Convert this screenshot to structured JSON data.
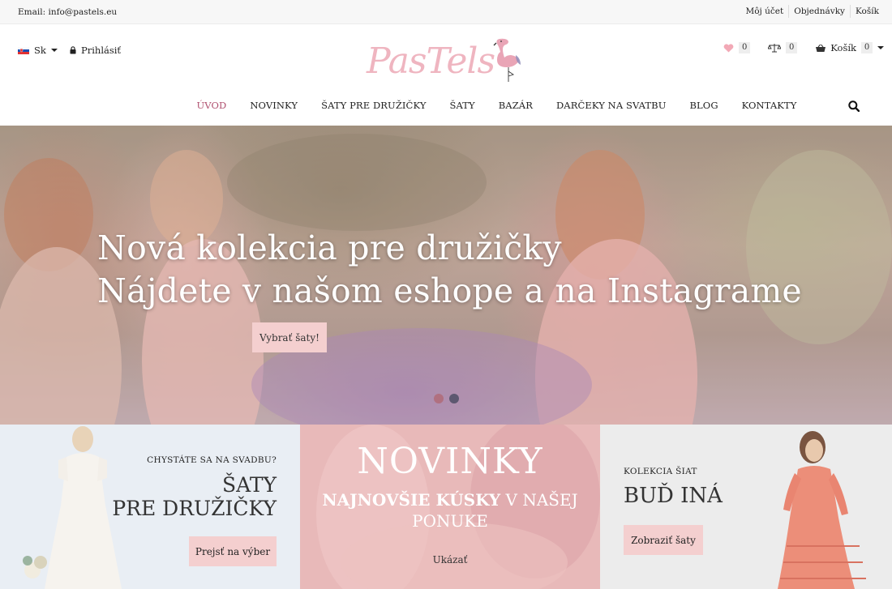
{
  "topbar": {
    "email": "Email: info@pastels.eu",
    "links": [
      "Môj účet",
      "Objednávky",
      "Košík"
    ]
  },
  "header": {
    "language": "Sk",
    "login": "Prihlásiť",
    "logo_text": "PasTels",
    "wishlist_count": "0",
    "compare_count": "0",
    "cart_label": "Košík",
    "cart_count": "0"
  },
  "nav": {
    "items": [
      "ÚVOD",
      "NOVINKY",
      "ŠATY PRE DRUŽIČKY",
      "ŠATY",
      "BAZÁR",
      "DARČEKY NA SVATBU",
      "BLOG",
      "KONTAKTY"
    ],
    "active_index": 0
  },
  "hero": {
    "line1": "Nová kolekcia pre družičky",
    "line2": "Nájdete v našom eshope a na Instagrame",
    "button": "Vybrať šaty!",
    "dot_colors": [
      "#b07080",
      "#5d5870"
    ]
  },
  "promos": {
    "bridesmaids": {
      "kicker": "CHYSTÁTE SA NA SVADBU?",
      "line1": "ŠATY",
      "line2": "PRE DRUŽIČKY",
      "button": "Prejsť na výber"
    },
    "news": {
      "title": "NOVINKY",
      "sub_bold": "NAJNOVŠIE KÚSKY",
      "sub_rest": " V NAŠEJ PONUKE",
      "link": "Ukázať"
    },
    "collection": {
      "kicker": "KOLEKCIA ŠIAT",
      "title": "BUĎ INÁ",
      "button": "Zobraziť šaty"
    }
  },
  "colors": {
    "accent": "#b0506f",
    "button_bg": "#f4cfcf",
    "logo_pink": "#e6a8b4"
  }
}
